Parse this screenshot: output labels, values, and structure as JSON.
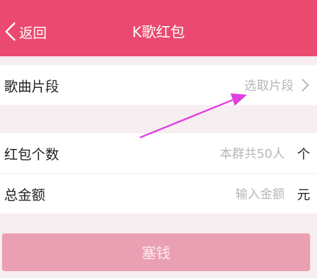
{
  "status_bar": {
    "text": ""
  },
  "navbar": {
    "back_label": "返回",
    "title": "K歌红包"
  },
  "song_row": {
    "label": "歌曲片段",
    "value": "选取片段"
  },
  "count_row": {
    "label": "红包个数",
    "placeholder": "本群共50人",
    "unit": "个"
  },
  "amount_row": {
    "label": "总金额",
    "placeholder": "输入金额",
    "unit": "元"
  },
  "submit_label": "塞钱",
  "colors": {
    "brand": "#ea4a6f",
    "button_disabled": "#eaa0b2",
    "annotation_arrow": "#e040e0"
  },
  "icons": [
    "chevron-left-icon",
    "chevron-right-icon",
    "annotation-arrow"
  ]
}
